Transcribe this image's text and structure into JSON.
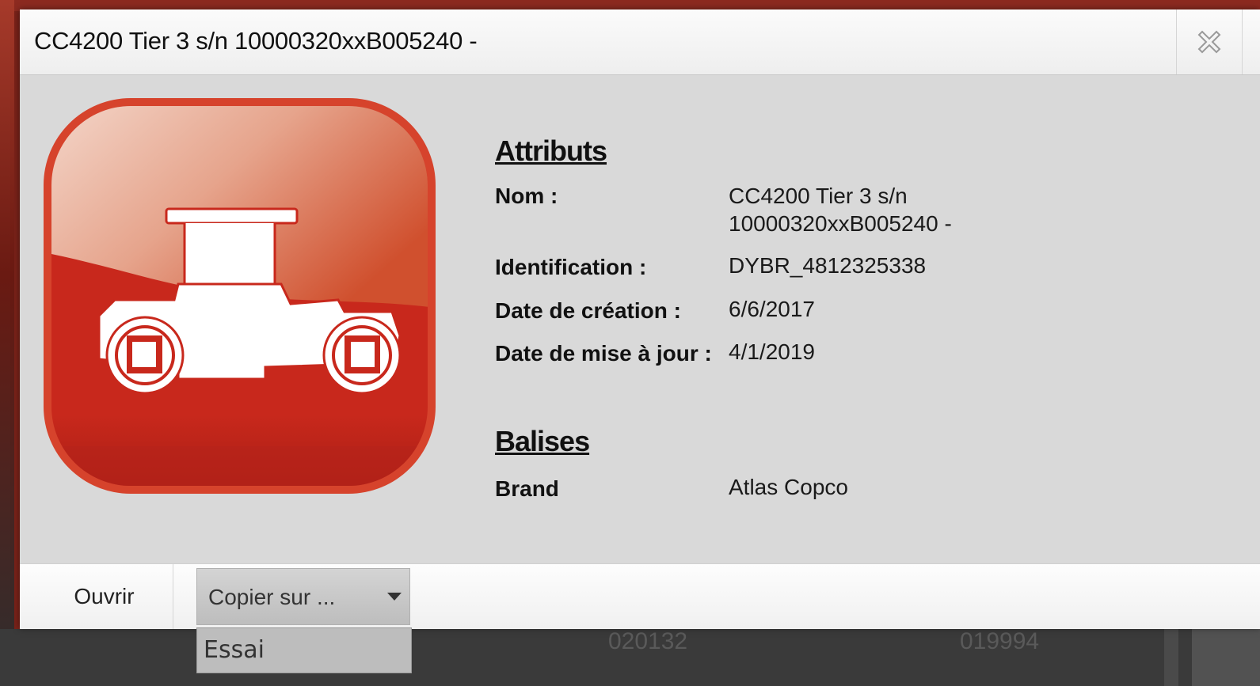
{
  "dialog": {
    "title": "CC4200 Tier 3 s/n 10000320xxB005240 -",
    "close_icon": "close-icon"
  },
  "thumbnail": {
    "icon": "compactor-roller-icon",
    "colors": {
      "dark": "#c8281c",
      "light": "#e8a080"
    }
  },
  "attributes": {
    "heading": "Attributs",
    "rows": [
      {
        "label": "Nom :",
        "value_line1": "CC4200 Tier 3 s/n",
        "value_line2": "10000320xxB005240 -"
      },
      {
        "label": "Identification :",
        "value": "DYBR_4812325338"
      },
      {
        "label": "Date de création :",
        "value": "6/6/2017"
      },
      {
        "label": "Date de mise à jour :",
        "value": "4/1/2019"
      }
    ]
  },
  "tags": {
    "heading": "Balises",
    "rows": [
      {
        "label": "Brand",
        "value": "Atlas Copco"
      }
    ]
  },
  "footer": {
    "open_label": "Ouvrir",
    "copy_to_label": "Copier sur ...",
    "copy_to_options": [
      "Essai"
    ]
  },
  "background_table": {
    "cells": [
      "020132",
      "019994"
    ]
  }
}
